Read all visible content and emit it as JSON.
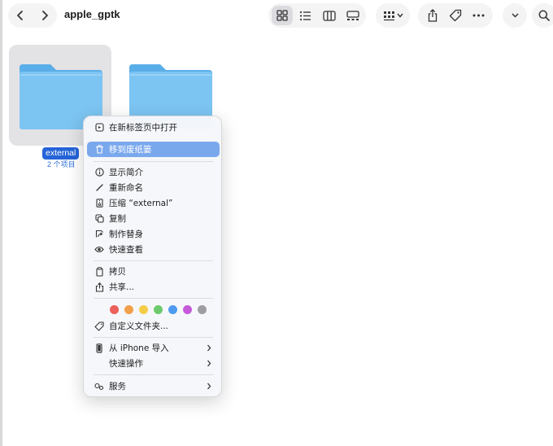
{
  "window": {
    "title": "apple_gptk"
  },
  "toolbar": {
    "back_icon": "chevron-left-icon",
    "forward_icon": "chevron-right-icon",
    "view_modes": [
      "icon-view",
      "list-view",
      "column-view",
      "gallery-view"
    ],
    "active_view": "icon-view"
  },
  "files": [
    {
      "name": "external",
      "subtitle": "2 个项目",
      "selected": true
    },
    {
      "name": "",
      "subtitle": "",
      "selected": false
    }
  ],
  "context_menu": {
    "items": [
      {
        "label": "在新标签页中打开",
        "icon": "new-tab-icon"
      },
      {
        "label": "移到废纸篓",
        "icon": "trash-icon",
        "highlighted": true
      },
      {
        "label": "显示简介",
        "icon": "info-icon"
      },
      {
        "label": "重新命名",
        "icon": "pencil-icon"
      },
      {
        "label": "压缩 “external”",
        "icon": "archive-icon"
      },
      {
        "label": "复制",
        "icon": "duplicate-icon"
      },
      {
        "label": "制作替身",
        "icon": "alias-icon"
      },
      {
        "label": "快速查看",
        "icon": "eye-icon"
      },
      {
        "label": "拷贝",
        "icon": "copy-icon"
      },
      {
        "label": "共享...",
        "icon": "share-icon"
      },
      {
        "label": "自定义文件夹...",
        "icon": "tag-icon"
      },
      {
        "label": "从 iPhone 导入",
        "icon": "iphone-icon",
        "submenu": true
      },
      {
        "label": "快速操作",
        "submenu": true
      },
      {
        "label": "服务",
        "icon": "services-icon",
        "submenu": true
      }
    ],
    "tag_colors": [
      "#ec5f5b",
      "#f2a04a",
      "#f4cd48",
      "#6cca6c",
      "#4d9bf0",
      "#c45ad8",
      "#9e9ea2"
    ]
  },
  "colors": {
    "accent": "#2563d8",
    "folder": "#72bdf0",
    "highlight": "#7aa8ec"
  }
}
